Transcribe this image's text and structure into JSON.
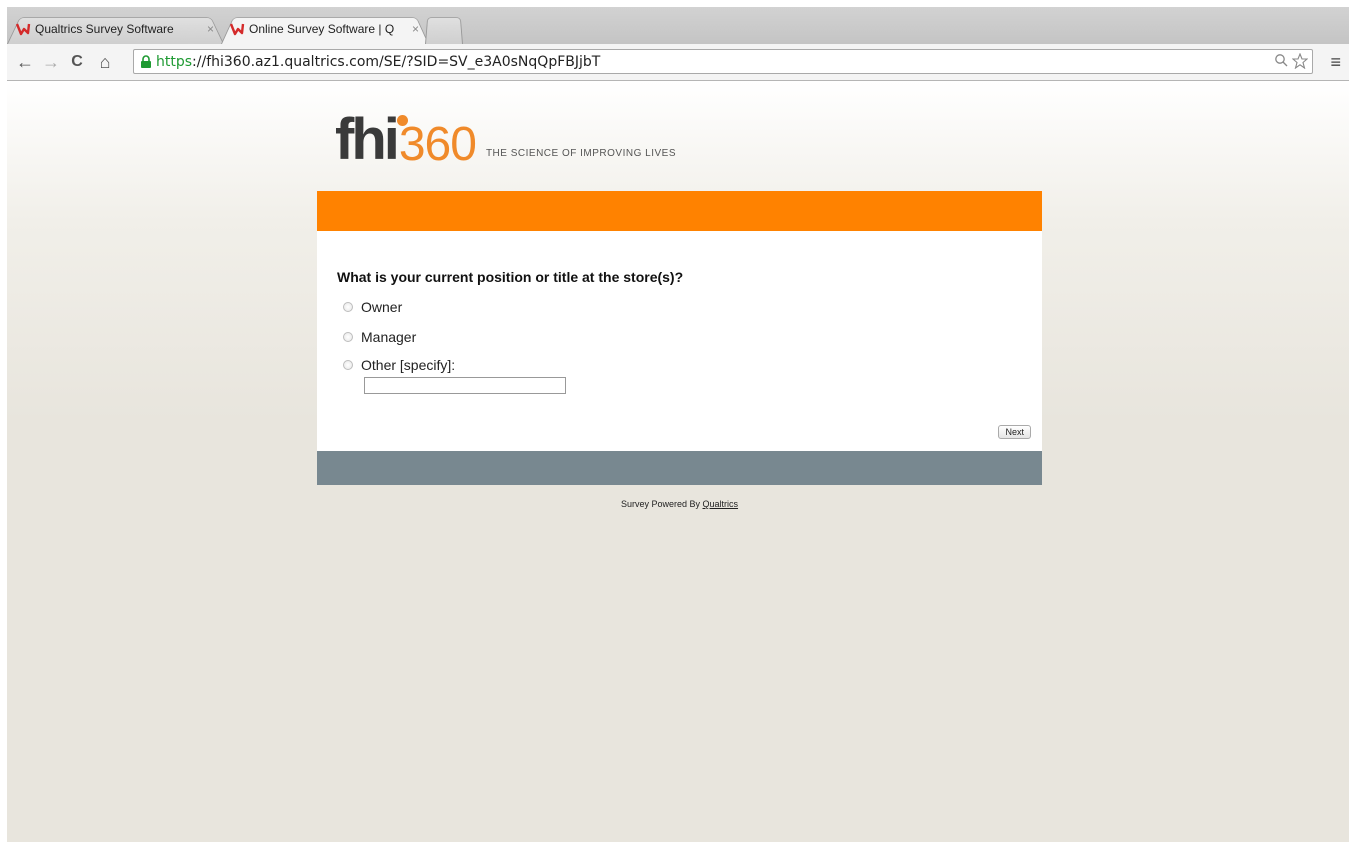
{
  "browser": {
    "tabs": [
      {
        "title": "Qualtrics Survey Software",
        "close": "×"
      },
      {
        "title": "Online Survey Software | Q",
        "close": "×"
      }
    ],
    "nav": {
      "back": "←",
      "forward": "→",
      "reload": "C",
      "home": "⌂"
    },
    "url": {
      "scheme": "https",
      "rest": "://fhi360.az1.qualtrics.com/SE/?SID=SV_e3A0sNqQpFBJjbT"
    },
    "menu": "≡"
  },
  "logo": {
    "fhi": "fhi",
    "number": "360",
    "tagline": "THE SCIENCE OF IMPROVING LIVES"
  },
  "colors": {
    "accent": "#ff8200",
    "footer_bar": "#788890",
    "logo_orange": "#f08a2a"
  },
  "survey": {
    "question": "What is your current position or title at the store(s)?",
    "choices": [
      "Owner",
      "Manager",
      "Other [specify]:"
    ],
    "specify_value": "",
    "next_label": "Next"
  },
  "footer": {
    "text": "Survey Powered By ",
    "link": "Qualtrics"
  }
}
